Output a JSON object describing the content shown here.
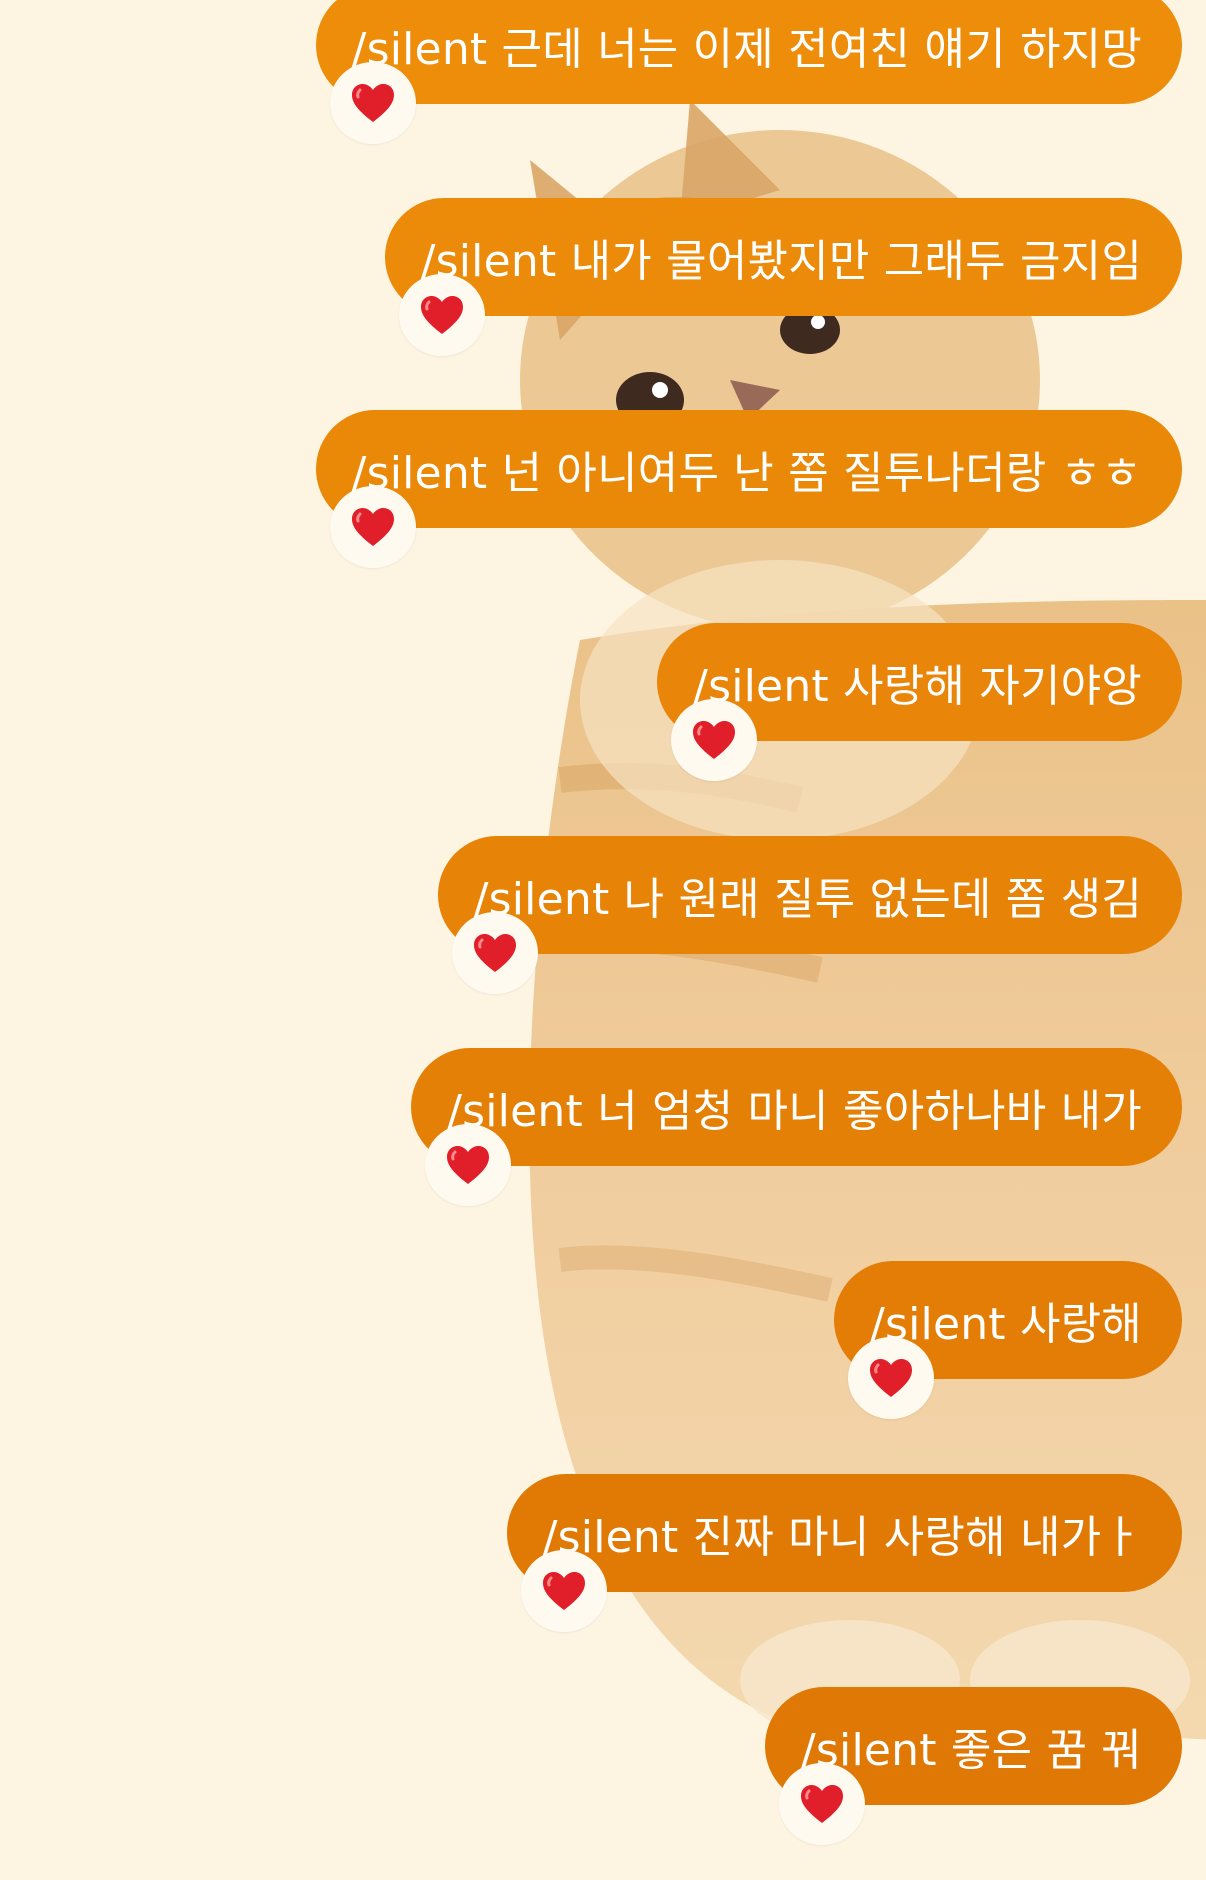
{
  "theme": {
    "bubble_colors": [
      "#ed8d0a",
      "#ec8b0a",
      "#ea8808",
      "#e98508",
      "#e78307",
      "#e58006",
      "#e37d05",
      "#e17a05",
      "#df7804"
    ],
    "wallpaper_color": "#fdf4e2",
    "reaction_icon": "red-heart-icon"
  },
  "messages": [
    {
      "text": "/silent 근데 너는 이제 전여친 얘기 하지망",
      "reaction": "❤️"
    },
    {
      "text": "/silent 내가 물어봤지만 그래두 금지임",
      "reaction": "❤️"
    },
    {
      "text": "/silent 넌 아니여두 난 쫌 질투나더랑 ㅎㅎ",
      "reaction": "❤️"
    },
    {
      "text": "/silent 사랑해 자기야앙",
      "reaction": "❤️"
    },
    {
      "text": "/silent 나 원래 질투 없는데 쫌 생김",
      "reaction": "❤️"
    },
    {
      "text": "/silent 너 엄청 마니 좋아하나바 내가",
      "reaction": "❤️"
    },
    {
      "text": "/silent 사랑해",
      "reaction": "❤️"
    },
    {
      "text": "/silent 진짜 마니 사랑해 내가ㅏ",
      "reaction": "❤️"
    },
    {
      "text": "/silent 좋은 꿈 꿔",
      "reaction": "❤️"
    }
  ]
}
